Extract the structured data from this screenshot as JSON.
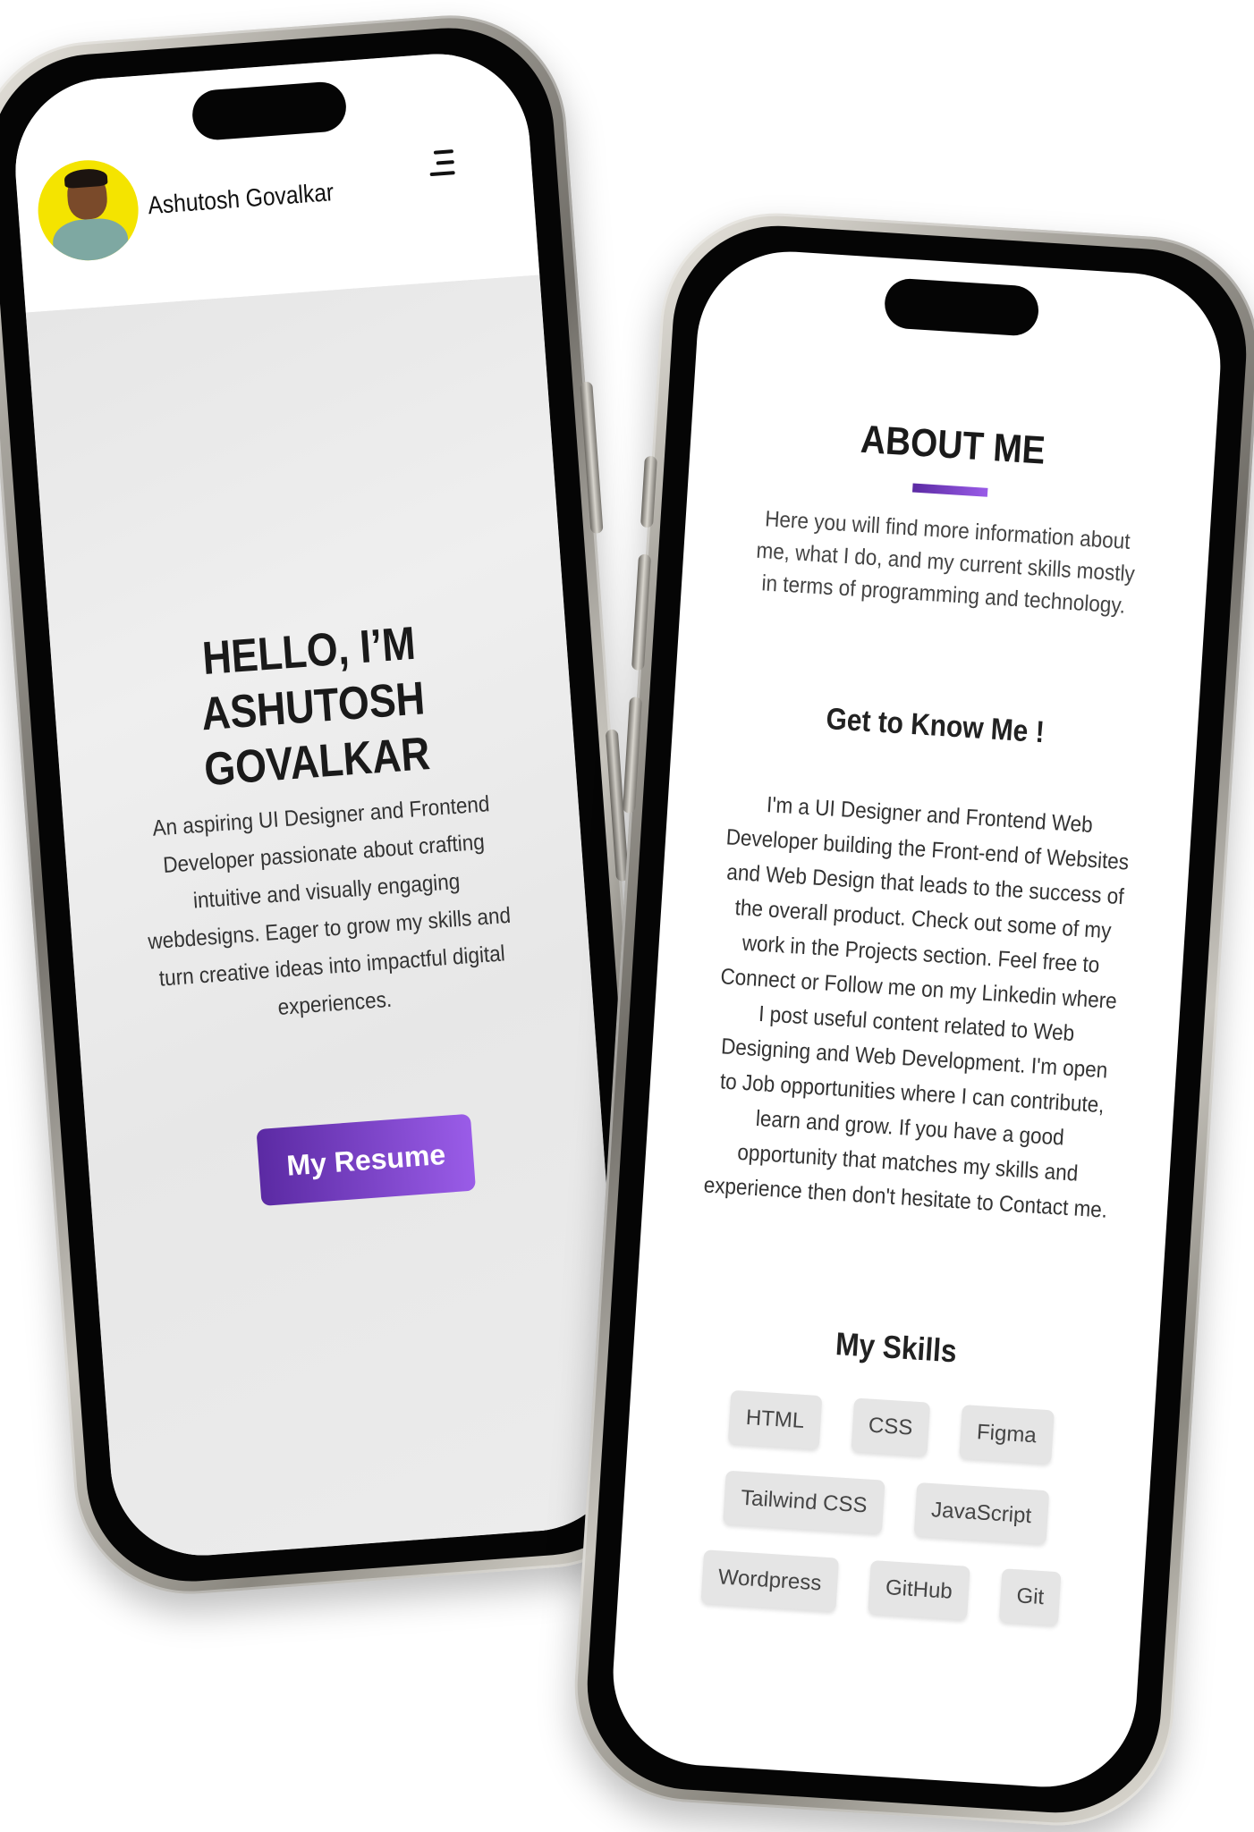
{
  "phone1": {
    "brand_name": "Ashutosh Govalkar",
    "hero_title": "HELLO, I’M ASHUTOSH GOVALKAR",
    "hero_description": "An aspiring UI Designer and Frontend Developer passionate about crafting intuitive and visually engaging webdesigns. Eager to grow my skills and turn creative ideas into impactful digital experiences.",
    "resume_button": "My Resume",
    "menu_icon": "hamburger-menu-icon"
  },
  "phone2": {
    "about_title": "ABOUT ME",
    "about_intro": "Here you will find more information about me, what I do, and my current skills mostly in terms of programming and technology.",
    "know_title": "Get to Know Me !",
    "know_body": "I'm a UI Designer and Frontend Web Developer building the Front-end of Websites and Web Design that leads to the success of the overall product. Check out some of my work in the Projects section. Feel free to Connect or Follow me on my Linkedin where I post useful content related to Web Designing and Web Development. I'm open to Job opportunities where I can contribute, learn and grow. If you have a good opportunity that matches my skills and experience then don't hesitate to Contact me.",
    "skills_title": "My Skills",
    "skills": [
      "HTML",
      "CSS",
      "Figma",
      "Tailwind CSS",
      "JavaScript",
      "Wordpress",
      "GitHub",
      "Git"
    ]
  },
  "colors": {
    "accent_start": "#5b2aa3",
    "accent_end": "#9a5ce8",
    "avatar_bg": "#f4e400"
  }
}
